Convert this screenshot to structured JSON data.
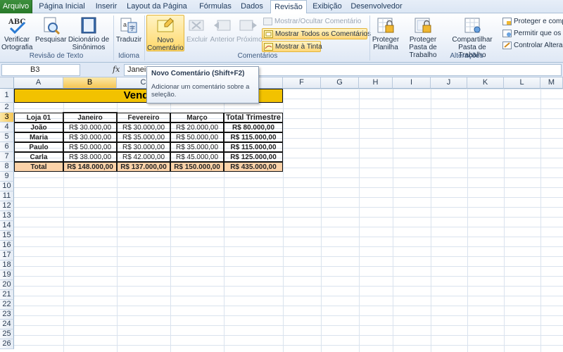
{
  "tabs": [
    "Arquivo",
    "Página Inicial",
    "Inserir",
    "Layout da Página",
    "Fórmulas",
    "Dados",
    "Revisão",
    "Exibição",
    "Desenvolvedor"
  ],
  "active_tab": "Revisão",
  "ribbon": {
    "groups": {
      "proofing": "Revisão de Texto",
      "language": "Idioma",
      "comments": "Comentários",
      "changes": "Alterações"
    },
    "spelling": "Verificar Ortografia",
    "research": "Pesquisar",
    "thesaurus": "Dicionário de Sinônimos",
    "translate": "Traduzir",
    "new_comment": "Novo Comentário",
    "delete": "Excluir",
    "previous": "Anterior",
    "next": "Próximo",
    "show_hide_comment": "Mostrar/Ocultar Comentário",
    "show_all_comments": "Mostrar Todos os Comentários",
    "show_ink": "Mostrar à Tinta",
    "protect_sheet": "Proteger Planilha",
    "protect_workbook": "Proteger Pasta de Trabalho",
    "share_workbook": "Compartilhar Pasta de Trabalho",
    "protect_share": "Proteger e comp",
    "allow_users": "Permitir que os U",
    "track_changes": "Controlar Alterag"
  },
  "formula_bar": {
    "name_box": "B3",
    "fx": "fx",
    "content": "Janeir"
  },
  "tooltip": {
    "title": "Novo Comentário (Shift+F2)",
    "body": "Adicionar um comentário sobre a seleção."
  },
  "columns": [
    "A",
    "B",
    "C",
    "D",
    "E",
    "F",
    "G",
    "H",
    "I",
    "J",
    "K",
    "L",
    "M"
  ],
  "rows": [
    "1",
    "2",
    "3",
    "4",
    "5",
    "6",
    "7",
    "8",
    "9",
    "10",
    "11",
    "12",
    "13",
    "14",
    "15",
    "16",
    "17",
    "18",
    "19",
    "20",
    "21",
    "22",
    "23",
    "24",
    "25",
    "26"
  ],
  "sheet": {
    "title": "Vendas Tr",
    "headers": [
      "Loja 01",
      "Janeiro",
      "Fevereiro",
      "Março",
      "Total Trimestre"
    ],
    "data": [
      [
        "João",
        "R$ 30.000,00",
        "R$ 30.000,00",
        "R$ 20.000,00",
        "R$ 80.000,00"
      ],
      [
        "Maria",
        "R$ 30.000,00",
        "R$ 35.000,00",
        "R$ 50.000,00",
        "R$ 115.000,00"
      ],
      [
        "Paulo",
        "R$ 50.000,00",
        "R$ 30.000,00",
        "R$ 35.000,00",
        "R$ 115.000,00"
      ],
      [
        "Carla",
        "R$ 38.000,00",
        "R$ 42.000,00",
        "R$ 45.000,00",
        "R$ 125.000,00"
      ]
    ],
    "totals": [
      "Total",
      "R$ 148.000,00",
      "R$ 137.000,00",
      "R$ 150.000,00",
      "R$ 435.000,00"
    ]
  },
  "colors": {
    "title_fill": "#f2c200",
    "total_fill": "#fbd2a8",
    "file_tab": "#2a7a2a"
  }
}
